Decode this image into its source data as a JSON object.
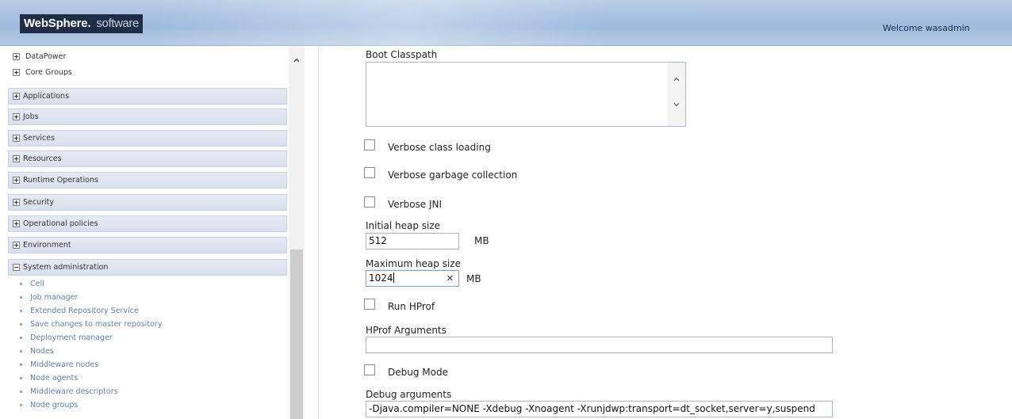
{
  "banner": {
    "brand": "WebSphere.",
    "product": "software",
    "welcome": "Welcome wasadmin"
  },
  "nav": {
    "tree_nodes": [
      "DataPower",
      "Core Groups"
    ],
    "categories": [
      {
        "label": "Applications",
        "expanded": false
      },
      {
        "label": "Jobs",
        "expanded": false
      },
      {
        "label": "Services",
        "expanded": false
      },
      {
        "label": "Resources",
        "expanded": false
      },
      {
        "label": "Runtime Operations",
        "expanded": false
      },
      {
        "label": "Security",
        "expanded": false
      },
      {
        "label": "Operational policies",
        "expanded": false
      },
      {
        "label": "Environment",
        "expanded": false
      },
      {
        "label": "System administration",
        "expanded": true
      }
    ],
    "system_admin_items": [
      "Cell",
      "Job manager",
      "Extended Repository Service",
      "Save changes to master repository",
      "Deployment manager",
      "Nodes",
      "Middleware nodes",
      "Node agents",
      "Middleware descriptors",
      "Node groups"
    ]
  },
  "form": {
    "boot_classpath_label": "Boot Classpath",
    "boot_classpath_value": "",
    "verbose_class_loading": {
      "label": "Verbose class loading",
      "checked": false
    },
    "verbose_gc": {
      "label": "Verbose garbage collection",
      "checked": false
    },
    "verbose_jni": {
      "label": "Verbose JNI",
      "checked": false
    },
    "initial_heap_label": "Initial heap size",
    "initial_heap_value": "512",
    "initial_heap_unit": "MB",
    "max_heap_label": "Maximum heap size",
    "max_heap_value": "1024",
    "max_heap_unit": "MB",
    "run_hprof": {
      "label": "Run HProf",
      "checked": false
    },
    "hprof_args_label": "HProf Arguments",
    "hprof_args_value": "",
    "debug_mode": {
      "label": "Debug Mode",
      "checked": false
    },
    "debug_args_label": "Debug arguments",
    "debug_args_value": "-Djava.compiler=NONE -Xdebug -Xnoagent -Xrunjdwp:transport=dt_socket,server=y,suspend"
  }
}
